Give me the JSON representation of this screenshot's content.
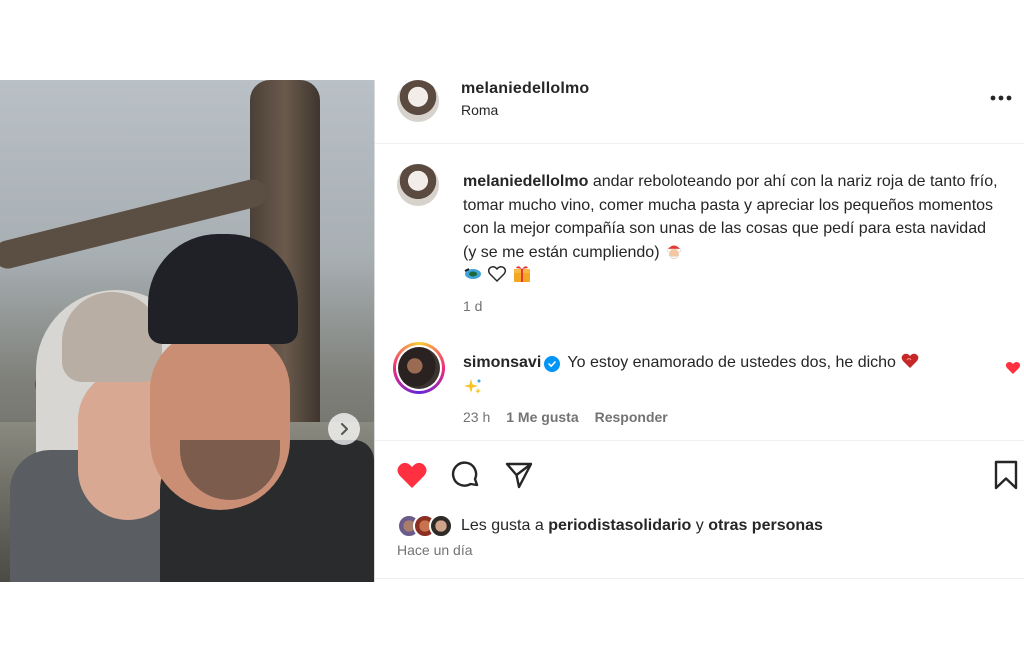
{
  "post": {
    "image_alt": "Pareja abrazada con gorros de lana frente a un árbol",
    "author": "melaniedellolmo",
    "location": "Roma",
    "caption": {
      "username": "melaniedellolmo",
      "text": "andar reboloteando por ahí con la nariz roja de tanto frío, tomar mucho vino, comer mucha pasta y apreciar los pequeños momentos con la mejor compañía son unas de las cosas que pedí para esta navidad (y se me están cumpliendo)",
      "time": "1 d"
    },
    "comment": {
      "username": "simonsavi",
      "text": "Yo estoy enamorado de ustedes dos, he dicho",
      "time": "23 h",
      "likes": "1 Me gusta",
      "reply": "Responder"
    },
    "likes": {
      "prefix": "Les gusta a",
      "user": "periodistasolidario",
      "connector": "y",
      "others": "otras personas"
    },
    "date": "Hace un día"
  },
  "icons": {
    "more": "more-horizontal-icon",
    "like": "heart-filled-icon",
    "comment": "comment-icon",
    "share": "send-icon",
    "save": "bookmark-icon",
    "next": "chevron-right-icon",
    "verified": "verified-badge-icon"
  },
  "colors": {
    "like_red": "#ff3040",
    "verified_blue": "#0095f6",
    "muted_text": "#737373"
  }
}
